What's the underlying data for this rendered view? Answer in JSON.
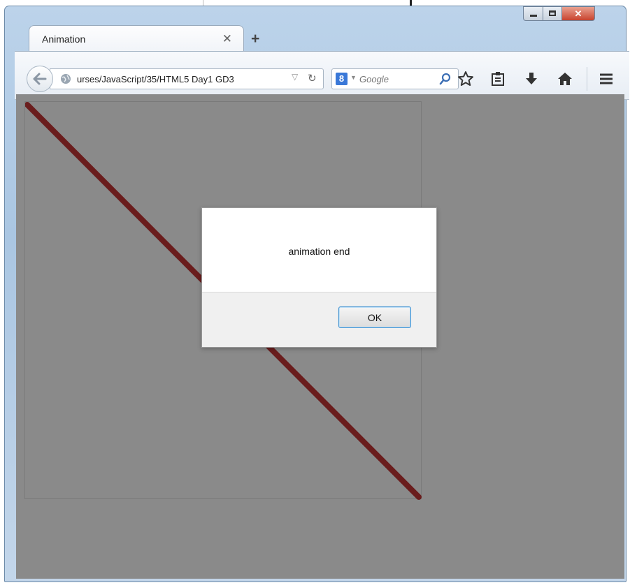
{
  "browser": {
    "tab": {
      "title": "Animation"
    },
    "address_bar": {
      "url": "urses/JavaScript/35/HTML5 Day1 GD3"
    },
    "search_bar": {
      "engine": "Google",
      "placeholder": "Google"
    }
  },
  "page": {
    "canvas": {
      "line_color": "#6a1d1d",
      "background_color": "#8a8a8a"
    }
  },
  "alert_dialog": {
    "message": "animation end",
    "ok_label": "OK"
  },
  "icons": [
    "back-arrow-icon",
    "globe-icon",
    "reload-icon",
    "search-icon",
    "bookmark-star-icon",
    "bookmarks-list-icon",
    "downloads-icon",
    "home-icon",
    "menu-icon",
    "close-icon",
    "plus-icon"
  ],
  "colors": {
    "window_frame": "#aac6e2",
    "close_button": "#c8442f",
    "ok_focus_border": "#3c8fd0"
  }
}
